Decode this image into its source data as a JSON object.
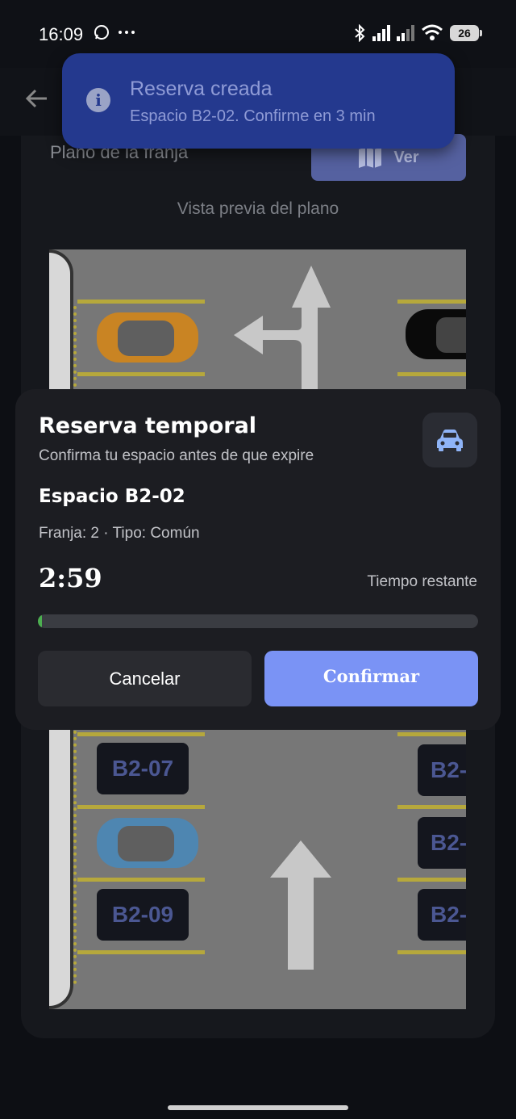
{
  "status_bar": {
    "time": "16:09",
    "battery": "26",
    "icons": [
      "whatsapp-icon",
      "more-icon",
      "bluetooth-icon",
      "signal-icon",
      "wifi-icon",
      "battery-icon"
    ]
  },
  "header": {
    "back_icon": "back-arrow-icon"
  },
  "plan": {
    "title": "Plano de la franja",
    "view_button": "Ver",
    "preview_label": "Vista previa del plano",
    "spots": [
      "B2-07",
      "B2-09",
      "B2-",
      "B2-",
      "B2-"
    ],
    "car_colors": [
      "#c98423",
      "#4e86b1",
      "#0a0a0a"
    ]
  },
  "toast": {
    "title": "Reserva creada",
    "subtitle": "Espacio B2-02. Confirme en 3 min",
    "icon": "info-icon",
    "color": "#24398e"
  },
  "sheet": {
    "title": "Reserva temporal",
    "subtitle": "Confirma tu espacio antes de que expire",
    "spot_title": "Espacio B2-02",
    "spot_meta": "Franja: 2 · Tipo: Común",
    "timer": "2:59",
    "timer_label": "Tiempo restante",
    "progress": 0.01,
    "cancel_label": "Cancelar",
    "confirm_label": "Confirmar",
    "accent": "#7a93f5"
  }
}
